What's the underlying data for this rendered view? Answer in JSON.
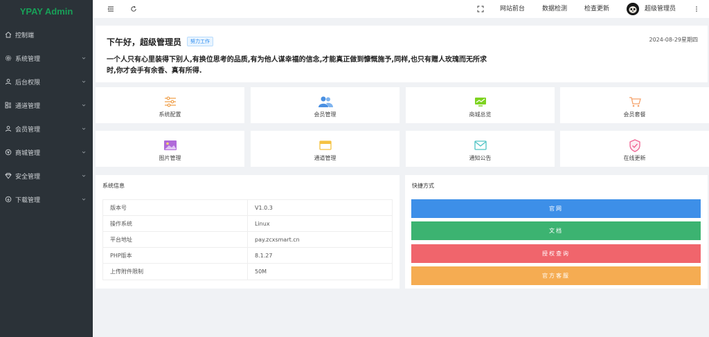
{
  "app": {
    "logo": "YPAY Admin"
  },
  "sidebar": {
    "items": [
      {
        "label": "控制端",
        "icon": "home-icon",
        "has_children": false
      },
      {
        "label": "系统管理",
        "icon": "gear-icon",
        "has_children": true
      },
      {
        "label": "后台权限",
        "icon": "user-icon",
        "has_children": true
      },
      {
        "label": "通道管理",
        "icon": "channel-icon",
        "has_children": true
      },
      {
        "label": "会员管理",
        "icon": "user-icon",
        "has_children": true
      },
      {
        "label": "商城管理",
        "icon": "shop-icon",
        "has_children": true
      },
      {
        "label": "安全管理",
        "icon": "shield-icon",
        "has_children": true
      },
      {
        "label": "下载管理",
        "icon": "download-icon",
        "has_children": true
      }
    ]
  },
  "topbar": {
    "links": [
      "网站前台",
      "数据检测",
      "检查更新"
    ],
    "username": "超级管理员"
  },
  "welcome": {
    "greeting": "下午好，超级管理员",
    "badge": "努力工作",
    "date": "2024-08-29星期四",
    "quote": "一个人只有心里装得下别人,有换位思考的品质,有为他人谋幸福的信念,才能真正做到慷慨施予,同样,也只有赠人玫瑰而无所求时,你才会手有余香、真有所得."
  },
  "tiles": [
    {
      "label": "系统配置",
      "icon": "sliders-icon",
      "color": "#f0a04b"
    },
    {
      "label": "会员管理",
      "icon": "users-icon",
      "color": "#4a90e2"
    },
    {
      "label": "商城总览",
      "icon": "chart-icon",
      "color": "#7ed321"
    },
    {
      "label": "会员套餐",
      "icon": "cart-icon",
      "color": "#f5a26a"
    },
    {
      "label": "图片管理",
      "icon": "image-icon",
      "color": "#b06ad9"
    },
    {
      "label": "通道管理",
      "icon": "window-icon",
      "color": "#f5c242"
    },
    {
      "label": "通知公告",
      "icon": "mail-icon",
      "color": "#4fc3c3"
    },
    {
      "label": "在线更新",
      "icon": "shield-check-icon",
      "color": "#f06292"
    }
  ],
  "sysinfo": {
    "title": "系统信息",
    "rows": [
      {
        "key": "版本号",
        "value": "V1.0.3"
      },
      {
        "key": "操作系统",
        "value": "Linux"
      },
      {
        "key": "平台地址",
        "value": "pay.zcxsmart.cn"
      },
      {
        "key": "PHP版本",
        "value": "8.1.27"
      },
      {
        "key": "上传附件限制",
        "value": "50M"
      }
    ]
  },
  "shortcuts": {
    "title": "快捷方式",
    "buttons": [
      {
        "label": "官网",
        "color": "#3d8fe8"
      },
      {
        "label": "文档",
        "color": "#3cb371"
      },
      {
        "label": "授权查询",
        "color": "#f0656c"
      },
      {
        "label": "官方客服",
        "color": "#f5ac52"
      }
    ]
  }
}
